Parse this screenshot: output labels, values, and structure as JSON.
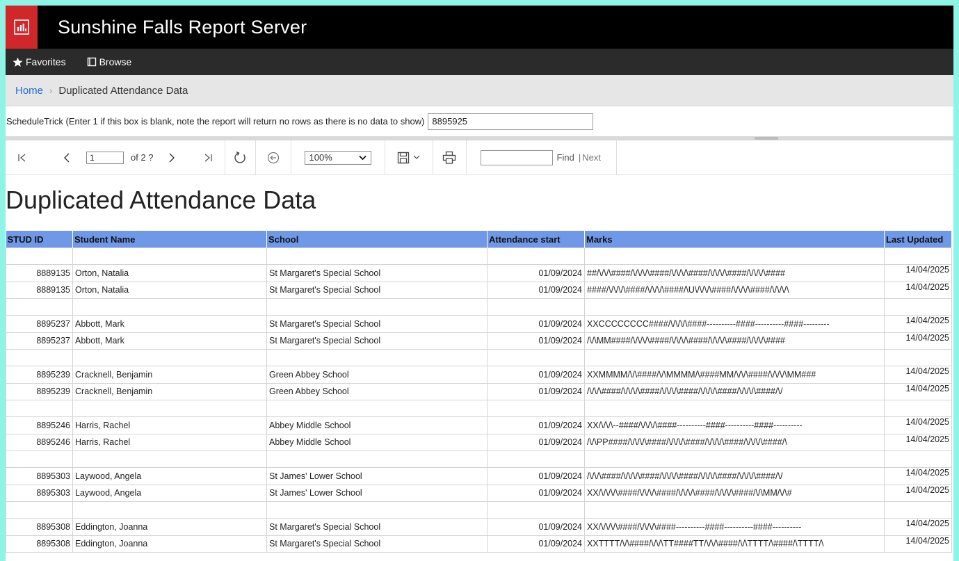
{
  "app": {
    "title": "Sunshine Falls Report Server",
    "accent": "#d0272b"
  },
  "nav": {
    "favorites": "Favorites",
    "browse": "Browse"
  },
  "breadcrumb": {
    "home": "Home",
    "current": "Duplicated Attendance Data"
  },
  "params": {
    "label": "ScheduleTrick (Enter 1 if this box is blank, note the report will return no rows as there is no data to show)",
    "value": "8895925"
  },
  "toolbar": {
    "page_value": "1",
    "page_of": "of 2 ?",
    "zoom": "100%",
    "find_label": "Find",
    "next_label": "Next",
    "separator": "|"
  },
  "report": {
    "title": "Duplicated Attendance Data",
    "headers": [
      "STUD ID",
      "Student Name",
      "School",
      "Attendance start",
      "Marks",
      "Last Updated"
    ],
    "rows": [
      {
        "id": "8889135",
        "name": "Orton, Natalia",
        "school": "St Margaret's Special School",
        "start": "01/09/2024",
        "marks": "##/\\/\\/\\####/\\/\\/\\/\\####/\\/\\/\\/\\####/\\/\\/\\/\\####/\\/\\/\\/\\####",
        "updated": "14/04/2025"
      },
      {
        "id": "8889135",
        "name": "Orton, Natalia",
        "school": "St Margaret's Special School",
        "start": "01/09/2024",
        "marks": "####/\\/\\/\\/\\####/\\/\\/\\/\\####/\\U\\/\\/\\/\\####/\\/\\/\\/\\####/\\/\\/\\/\\",
        "updated": "14/04/2025"
      },
      {
        "id": "8895237",
        "name": "Abbott, Mark",
        "school": "St Margaret's Special School",
        "start": "01/09/2024",
        "marks": "XXCCCCCCCC####/\\/\\/\\/\\####----------####----------####---------",
        "updated": "14/04/2025"
      },
      {
        "id": "8895237",
        "name": "Abbott, Mark",
        "school": "St Margaret's Special School",
        "start": "01/09/2024",
        "marks": "/\\/\\MM####/\\/\\/\\/\\####/\\/\\/\\/\\####/\\/\\/\\/\\####/\\/\\/\\/\\####",
        "updated": "14/04/2025"
      },
      {
        "id": "8895239",
        "name": "Cracknell, Benjamin",
        "school": "Green Abbey School",
        "start": "01/09/2024",
        "marks": "XXMMMM/\\/\\####/\\/\\MMMM/\\####MM/\\/\\/\\####/\\/\\/\\/\\MM###",
        "updated": "14/04/2025"
      },
      {
        "id": "8895239",
        "name": "Cracknell, Benjamin",
        "school": "Green Abbey School",
        "start": "01/09/2024",
        "marks": "/\\/\\/\\####/\\/\\/\\/\\####/\\/\\/\\/\\####/\\/\\/\\/\\####/\\/\\/\\/\\####/\\/",
        "updated": "14/04/2025"
      },
      {
        "id": "8895246",
        "name": "Harris, Rachel",
        "school": "Abbey Middle School",
        "start": "01/09/2024",
        "marks": "XX/\\/\\/\\--####/\\/\\/\\/\\####----------####----------####----------",
        "updated": "14/04/2025"
      },
      {
        "id": "8895246",
        "name": "Harris, Rachel",
        "school": "Abbey Middle School",
        "start": "01/09/2024",
        "marks": "/\\/\\PP####/\\/\\/\\/\\####/\\/\\/\\/\\####/\\/\\/\\/\\####/\\/\\/\\/\\####/\\",
        "updated": "14/04/2025"
      },
      {
        "id": "8895303",
        "name": "Laywood, Angela",
        "school": "St James' Lower School",
        "start": "01/09/2024",
        "marks": "/\\/\\/\\####/\\/\\/\\/\\####/\\/\\/\\/\\####/\\/\\/\\/\\####/\\/\\/\\/\\####/\\/",
        "updated": "14/04/2025"
      },
      {
        "id": "8895303",
        "name": "Laywood, Angela",
        "school": "St James' Lower School",
        "start": "01/09/2024",
        "marks": "XX/\\/\\/\\/\\####/\\/\\/\\/\\####/\\/\\/\\/\\####/\\/\\/\\/\\####/\\/\\MM/\\/\\#",
        "updated": "14/04/2025"
      },
      {
        "id": "8895308",
        "name": "Eddington, Joanna",
        "school": "St Margaret's Special School",
        "start": "01/09/2024",
        "marks": "XX/\\/\\/\\/\\####/\\/\\/\\/\\####----------####----------####----------",
        "updated": "14/04/2025"
      },
      {
        "id": "8895308",
        "name": "Eddington, Joanna",
        "school": "St Margaret's Special School",
        "start": "01/09/2024",
        "marks": "XXTTTT/\\/\\####/\\/\\/\\TT####TT/\\/\\/\\####/\\/\\TTTT/\\####/\\TTTT/\\",
        "updated": "14/04/2025"
      }
    ]
  }
}
